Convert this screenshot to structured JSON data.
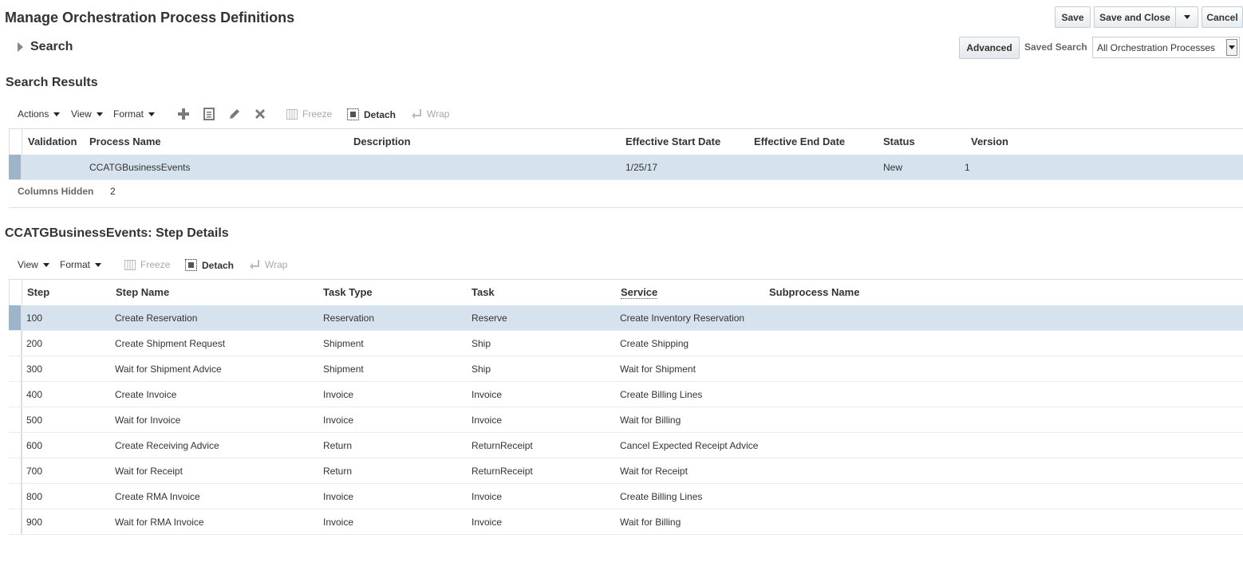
{
  "page": {
    "title": "Manage Orchestration Process Definitions",
    "buttons": {
      "save": "Save",
      "save_and_close": "Save and Close",
      "cancel": "Cancel"
    }
  },
  "search": {
    "label": "Search",
    "advanced_label": "Advanced",
    "saved_search_label": "Saved Search",
    "saved_search_value": "All Orchestration Processes"
  },
  "results": {
    "title": "Search Results",
    "toolbar": {
      "actions": "Actions",
      "view": "View",
      "format": "Format",
      "freeze": "Freeze",
      "detach": "Detach",
      "wrap": "Wrap"
    },
    "columns": [
      "Validation",
      "Process Name",
      "Description",
      "Effective Start Date",
      "Effective End Date",
      "Status",
      "Version"
    ],
    "rows": [
      {
        "validation": "",
        "process_name": "CCATGBusinessEvents",
        "description": "",
        "start_date": "1/25/17",
        "end_date": "",
        "status": "New",
        "version": "1"
      }
    ],
    "columns_hidden_label": "Columns Hidden",
    "columns_hidden_value": "2"
  },
  "steps": {
    "title": "CCATGBusinessEvents: Step Details",
    "toolbar": {
      "view": "View",
      "format": "Format",
      "freeze": "Freeze",
      "detach": "Detach",
      "wrap": "Wrap"
    },
    "columns": [
      "Step",
      "Step Name",
      "Task Type",
      "Task",
      "Service",
      "Subprocess Name"
    ],
    "rows": [
      {
        "step": "100",
        "name": "Create Reservation",
        "task_type": "Reservation",
        "task": "Reserve",
        "service": "Create Inventory Reservation",
        "subprocess": ""
      },
      {
        "step": "200",
        "name": "Create Shipment Request",
        "task_type": "Shipment",
        "task": "Ship",
        "service": "Create Shipping",
        "subprocess": ""
      },
      {
        "step": "300",
        "name": "Wait for Shipment Advice",
        "task_type": "Shipment",
        "task": "Ship",
        "service": "Wait for Shipment",
        "subprocess": ""
      },
      {
        "step": "400",
        "name": "Create Invoice",
        "task_type": "Invoice",
        "task": "Invoice",
        "service": "Create Billing Lines",
        "subprocess": ""
      },
      {
        "step": "500",
        "name": "Wait for Invoice",
        "task_type": "Invoice",
        "task": "Invoice",
        "service": "Wait for Billing",
        "subprocess": ""
      },
      {
        "step": "600",
        "name": "Create Receiving Advice",
        "task_type": "Return",
        "task": "ReturnReceipt",
        "service": "Cancel Expected Receipt Advice",
        "subprocess": ""
      },
      {
        "step": "700",
        "name": "Wait for Receipt",
        "task_type": "Return",
        "task": "ReturnReceipt",
        "service": "Wait for Receipt",
        "subprocess": ""
      },
      {
        "step": "800",
        "name": "Create RMA Invoice",
        "task_type": "Invoice",
        "task": "Invoice",
        "service": "Create Billing Lines",
        "subprocess": ""
      },
      {
        "step": "900",
        "name": "Wait for RMA Invoice",
        "task_type": "Invoice",
        "task": "Invoice",
        "service": "Wait for Billing",
        "subprocess": ""
      }
    ]
  },
  "colors": {
    "selected_row": "#d6e3ef",
    "row_header_selected": "#9eb4c8",
    "border": "#d6dfe6"
  }
}
